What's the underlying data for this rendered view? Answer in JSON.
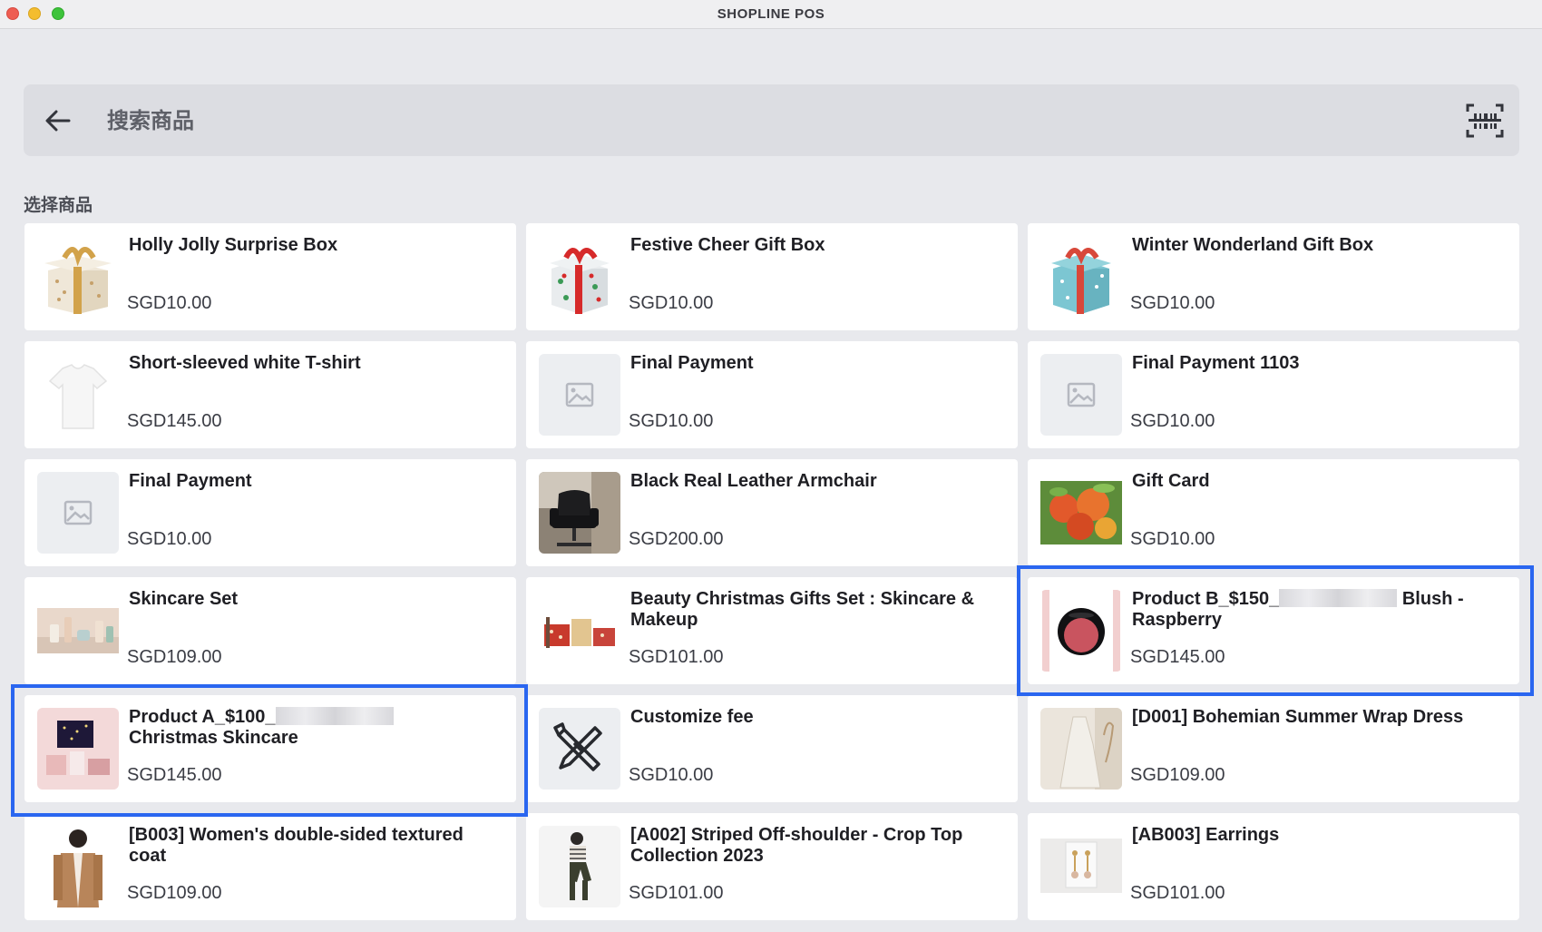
{
  "window": {
    "title": "SHOPLINE POS"
  },
  "search": {
    "placeholder": "搜索商品"
  },
  "section": {
    "label": "选择商品"
  },
  "colors": {
    "highlight": "#2a66f0",
    "page_bg": "#e8e9ed",
    "card_bg": "#ffffff"
  },
  "products": [
    {
      "name": "Holly Jolly Surprise Box",
      "price": "SGD10.00",
      "image": "gift-box-gold"
    },
    {
      "name": "Festive Cheer Gift Box",
      "price": "SGD10.00",
      "image": "gift-box-red"
    },
    {
      "name": "Winter Wonderland Gift Box",
      "price": "SGD10.00",
      "image": "gift-box-blue"
    },
    {
      "name": "Short-sleeved white T-shirt",
      "price": "SGD145.00",
      "image": "white-tshirt"
    },
    {
      "name": "Final Payment",
      "price": "SGD10.00",
      "image": "placeholder"
    },
    {
      "name": "Final Payment 1103",
      "price": "SGD10.00",
      "image": "placeholder"
    },
    {
      "name": "Final Payment",
      "price": "SGD10.00",
      "image": "placeholder"
    },
    {
      "name": "Black Real Leather Armchair",
      "price": "SGD200.00",
      "image": "armchair"
    },
    {
      "name": "Gift Card",
      "price": "SGD10.00",
      "image": "apples"
    },
    {
      "name": "Skincare Set",
      "price": "SGD109.00",
      "image": "skincare"
    },
    {
      "name": "Beauty Christmas Gifts Set : Skincare & Makeup",
      "price": "SGD101.00",
      "image": "beauty-set"
    },
    {
      "name_prefix": "Product B_$150_",
      "name_suffix": "Blush - Raspberry",
      "price": "SGD145.00",
      "image": "blush",
      "highlighted": true
    },
    {
      "name_prefix": "Product A_$100_",
      "name_suffix": "Christmas Skincare",
      "price": "SGD145.00",
      "image": "christmas-skincare",
      "highlighted": true
    },
    {
      "name": "Customize fee",
      "price": "SGD10.00",
      "image": "tools"
    },
    {
      "name": "[D001] Bohemian Summer Wrap Dress",
      "price": "SGD109.00",
      "image": "dress"
    },
    {
      "name": "[B003] Women's double-sided textured coat",
      "price": "SGD109.00",
      "image": "coat"
    },
    {
      "name": "[A002] Striped Off-shoulder - Crop Top Collection 2023",
      "price": "SGD101.00",
      "image": "croptop"
    },
    {
      "name": "[AB003] Earrings",
      "price": "SGD101.00",
      "image": "earrings"
    }
  ]
}
